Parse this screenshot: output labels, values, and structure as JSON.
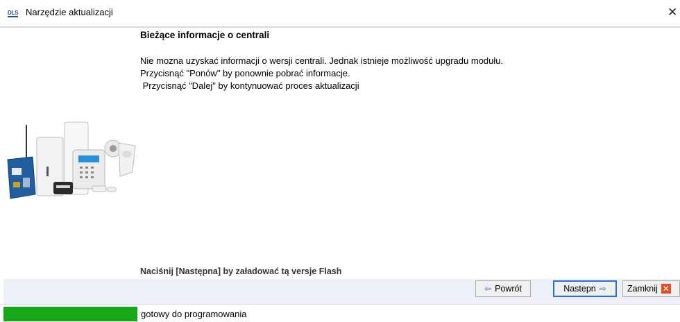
{
  "window": {
    "title": "Narzędzie aktualizacji",
    "app_icon_text": "DLS",
    "close_glyph": "✕"
  },
  "main": {
    "heading": "Bieżące informacje o centrali",
    "lines": [
      "Nie mozna uzyskać informacji o wersji centrali. Jednak istnieje możliwość upgradu modułu.",
      "Przycisnąć \"Ponów\" by ponownie pobrać informacje.",
      " Przycisnąć \"Dalej\" by kontynuować proces aktualizacji"
    ],
    "hint": "Naciśnij [Następna] by załadować tą versje Flash",
    "image": "security-devices-product-image"
  },
  "buttons": {
    "back_label": "Powrót",
    "back_icon": "arrow-left-icon",
    "next_label": "Nastepn",
    "next_icon": "arrow-right-icon",
    "close_label": "Zamknij",
    "close_icon": "close-x-icon"
  },
  "status": {
    "text": "gotowy do programowania",
    "progress": 1.0,
    "progress_color": "#16a816"
  },
  "colors": {
    "accent": "#2a6fd6",
    "close_red": "#e84b1f",
    "button_bar": "#eef0f7"
  }
}
